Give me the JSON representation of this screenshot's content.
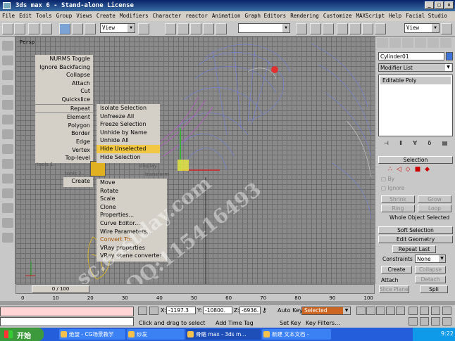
{
  "window": {
    "title": "3ds max 6 - Stand-alone License",
    "min": "_",
    "max": "□",
    "close": "×"
  },
  "menu": [
    "File",
    "Edit",
    "Tools",
    "Group",
    "Views",
    "Create",
    "Modifiers",
    "Character",
    "reactor",
    "Animation",
    "Graph Editors",
    "Rendering",
    "Customize",
    "MAXScript",
    "Help",
    "Facial Studio"
  ],
  "toolbar": {
    "refcoord": "View",
    "refcoord2": "View",
    "named_sel": ""
  },
  "viewport": {
    "label": "Persp"
  },
  "quad_left": {
    "items": [
      "NURMS Toggle",
      "Ignore Backfacing",
      "Collapse",
      "Attach",
      "Cut",
      "Quickslice",
      "Repeat",
      "Element",
      "Polygon",
      "Border",
      "Edge",
      "Vertex",
      "Top-level"
    ],
    "label1": "tools 1",
    "label2": "tools 2",
    "create": "Create"
  },
  "quad_right": {
    "items": [
      "Isolate Selection",
      "Unfreeze All",
      "Freeze Selection",
      "Unhide by Name",
      "Unhide All",
      "Hide Unselected",
      "Hide Selection"
    ],
    "label_display": "display",
    "label_transform": "transform"
  },
  "quad_bottom": {
    "items": [
      "Move",
      "Rotate",
      "Scale",
      "Clone",
      "Properties...",
      "Curve Editor...",
      "Wire Parameters..."
    ],
    "convert": "Convert To:",
    "vray1": "VRay properties",
    "vray2": "VRay scene converter"
  },
  "watermark": {
    "line1": "sc.eastday.com",
    "line2": "QQ:115416493"
  },
  "command_panel": {
    "object_name": "Cylinder01",
    "color": "#3e73d8",
    "modifier_list": "Modifier List",
    "stack_item": "Editable Poly",
    "selection": "Selection",
    "by": "By",
    "ignore": "Ignore",
    "shrink": "Shrink",
    "grow": "Grow",
    "ring": "Ring",
    "loop": "Loop",
    "whole_object": "Whole Object Selected",
    "soft_selection": "Soft Selection",
    "edit_geometry": "Edit Geometry",
    "repeat_last": "Repeat Last",
    "constraints": "Constraints",
    "constraints_value": "None",
    "create": "Create",
    "collapse": "Collapse",
    "attach": "Attach",
    "detach": "Detach",
    "slice_plane": "Slice Plane",
    "split": "Spli"
  },
  "time": {
    "slider": "0 / 100",
    "ticks": [
      "0",
      "10",
      "20",
      "30",
      "40",
      "50",
      "60",
      "70",
      "80",
      "90",
      "100"
    ]
  },
  "status": {
    "x_label": "X:",
    "x": "-1197.3",
    "y_label": "Y:",
    "y": "-10800.",
    "z_label": "Z:",
    "z": "-6936.",
    "prompt": "Click and drag to select",
    "add_time_tag": "Add Time Tag",
    "auto_key": "Auto Key",
    "set_key": "Set Key",
    "key_filters": "Key Filters...",
    "selected": "Selected"
  },
  "taskbar": {
    "start": "开始",
    "tasks": [
      "绝望 - CG场景教学",
      "纱发",
      "骨骼 max - 3ds m...",
      "新建 文本文档 -"
    ],
    "time": "9:22"
  }
}
